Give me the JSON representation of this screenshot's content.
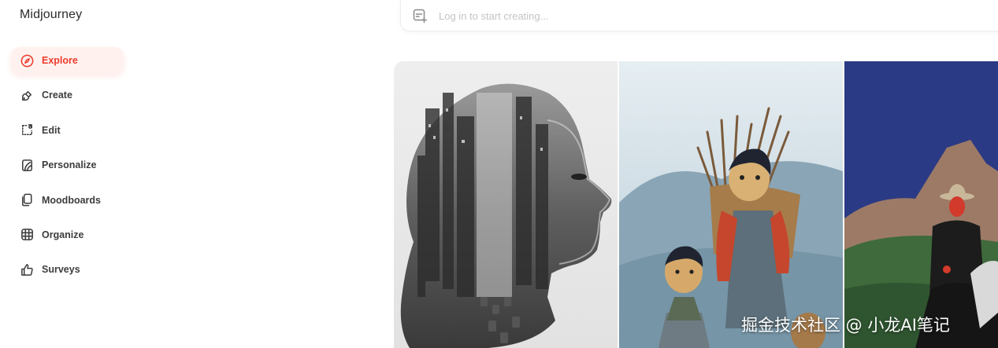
{
  "app": {
    "brand": "Midjourney"
  },
  "sidebar": {
    "items": [
      {
        "label": "Explore",
        "icon": "compass-icon",
        "active": true
      },
      {
        "label": "Create",
        "icon": "brush-icon",
        "active": false
      },
      {
        "label": "Edit",
        "icon": "edit-crop-icon",
        "active": false
      },
      {
        "label": "Personalize",
        "icon": "personalize-icon",
        "active": false
      },
      {
        "label": "Moodboards",
        "icon": "moodboard-icon",
        "active": false
      },
      {
        "label": "Organize",
        "icon": "grid-icon",
        "active": false
      },
      {
        "label": "Surveys",
        "icon": "thumbs-up-icon",
        "active": false
      }
    ]
  },
  "prompt": {
    "placeholder": "Log in to start creating..."
  },
  "gallery": {
    "images": [
      {
        "subject": "double-exposure-woman-city-portrait"
      },
      {
        "subject": "clay-children-carrying-firewood"
      },
      {
        "subject": "painted-rider-in-red-landscape"
      }
    ]
  },
  "watermark": "掘金技术社区 @ 小龙AI笔记",
  "colors": {
    "accent": "#ec3b2b",
    "active_bg": "#fff1ee",
    "text": "#3d3d3d"
  }
}
